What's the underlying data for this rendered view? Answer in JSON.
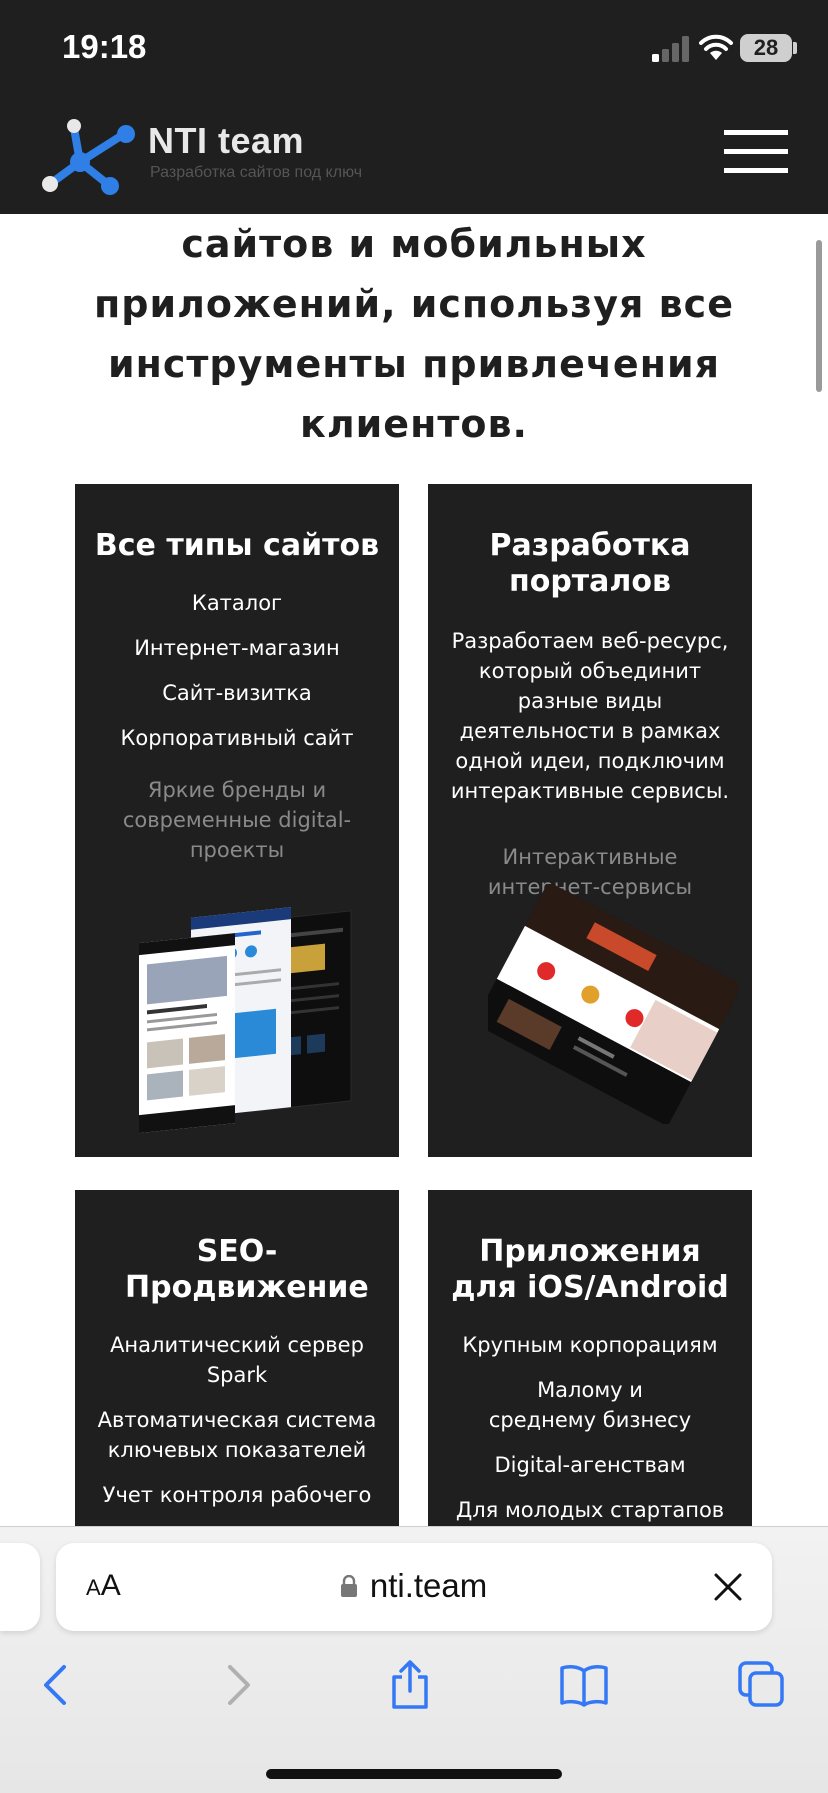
{
  "status_bar": {
    "time": "19:18",
    "battery": "28"
  },
  "header": {
    "logo_title": "NTI team",
    "logo_subtitle": "Разработка сайтов под ключ"
  },
  "main": {
    "headline_lines": [
      "сайтов и мобильных",
      "приложений, используя все",
      "инструменты привлечения",
      "клиентов."
    ],
    "cards": [
      {
        "title": "Все типы сайтов",
        "items": [
          "Каталог",
          "Интернет-магазин",
          "Сайт-визитка",
          "Корпоративный сайт"
        ],
        "muted": "Яркие бренды и современные digital-проекты"
      },
      {
        "title": "Разработка порталов",
        "description": "Разработаем веб-ресурс, который объединит разные виды деятельности в рамках одной идеи, подключим интерактивные сервисы.",
        "muted": "Интерактивные интернет-сервисы"
      },
      {
        "title": "SEO-Продвижение",
        "items": [
          "Аналитический сервер Spark",
          "Автоматическая система ключевых показателей",
          "Учет контроля рабочего"
        ]
      },
      {
        "title": "Приложения для iOS/Android",
        "items": [
          "Крупным корпорациям",
          "Малому и среднему бизнесу",
          "Digital-агенствам",
          "Для молодых стартапов"
        ]
      }
    ]
  },
  "browser": {
    "aa_label_small": "A",
    "aa_label_large": "A",
    "url": "nti.team",
    "accent_color": "#3478f6"
  }
}
